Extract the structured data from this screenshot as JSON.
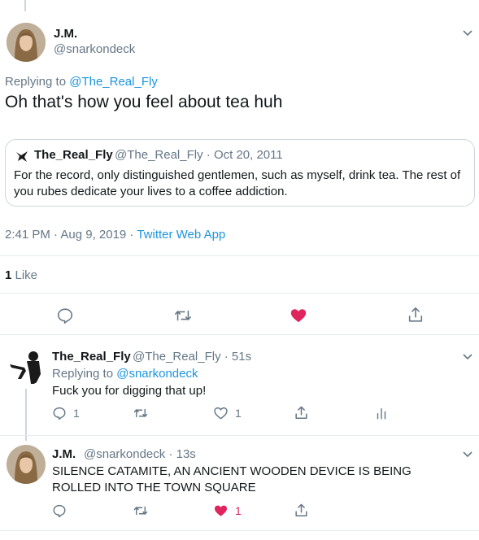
{
  "main_tweet": {
    "author_name": "J.M.",
    "author_handle": "@snarkondeck",
    "replying_prefix": "Replying to ",
    "replying_to": "@The_Real_Fly",
    "text": "Oh that's how you feel about tea huh",
    "quoted": {
      "author_name": "The_Real_Fly",
      "author_handle": "@The_Real_Fly",
      "date": "· Oct 20, 2011",
      "text": "For the record, only distinguished gentlemen, such as myself, drink tea. The rest of you rubes dedicate your lives to a coffee addiction."
    },
    "time": "2:41 PM · Aug 9, 2019 · ",
    "source": "Twitter Web App",
    "like_count": "1",
    "like_label": " Like"
  },
  "reply_1": {
    "author_name": "The_Real_Fly",
    "meta": "@The_Real_Fly · 51s",
    "replying_prefix": "Replying to ",
    "replying_to": "@snarkondeck",
    "text": "Fuck you for digging that up!",
    "reply_count": "1",
    "like_count": "1"
  },
  "reply_2": {
    "author_name": "J.M.",
    "meta": "@snarkondeck · 13s",
    "text": "SILENCE CATAMITE, AN ANCIENT WOODEN DEVICE IS BEING ROLLED INTO THE TOWN SQUARE",
    "like_count": "1"
  },
  "colors": {
    "link": "#1b95e0",
    "secondary": "#657786",
    "liked": "#e0245e",
    "border": "#e6ecf0"
  },
  "icons": [
    "reply-icon",
    "retweet-icon",
    "like-icon",
    "share-icon",
    "analytics-icon",
    "chevron-down-icon"
  ]
}
